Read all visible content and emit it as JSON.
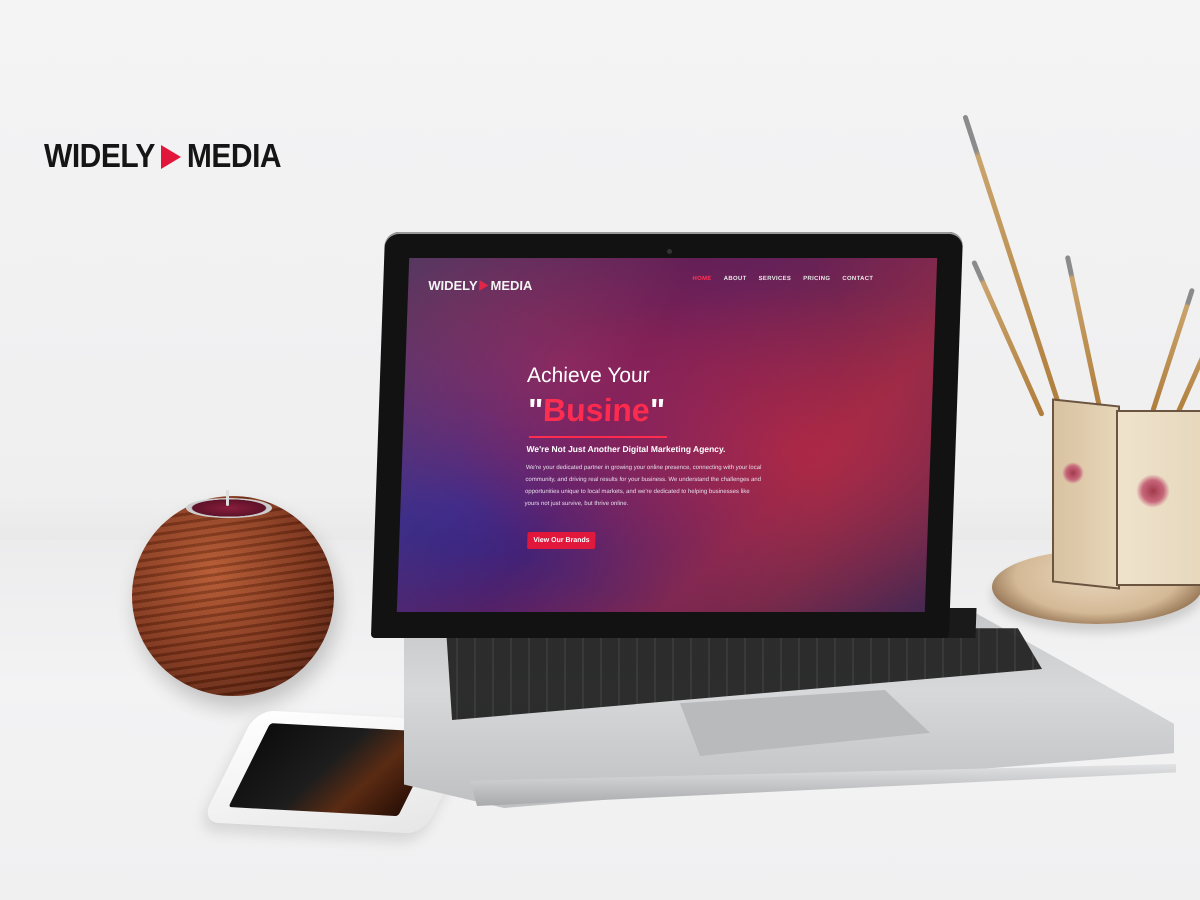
{
  "brand": {
    "left": "WIDELY",
    "right": "MEDIA"
  },
  "colors": {
    "accent": "#e1163a",
    "brand_play": "#e1163a"
  },
  "laptop_site": {
    "logo": {
      "left": "WIDELY",
      "right": "MEDIA"
    },
    "nav": [
      "HOME",
      "ABOUT",
      "SERVICES",
      "PRICING",
      "CONTACT"
    ],
    "nav_active": "HOME",
    "hero": {
      "title": "Achieve Your",
      "typed_word": "Busine",
      "quote_open": "\"",
      "quote_close": "\"",
      "subtitle": "We're Not Just Another Digital Marketing Agency.",
      "body": "We're your dedicated partner in growing your online presence, connecting with your local community, and driving real results for your business. We understand the challenges and opportunities unique to local markets, and we're dedicated to helping businesses like yours not just survive, but thrive online.",
      "cta": "View Our Brands"
    }
  },
  "icons": [
    "play-icon",
    "camera-icon"
  ]
}
